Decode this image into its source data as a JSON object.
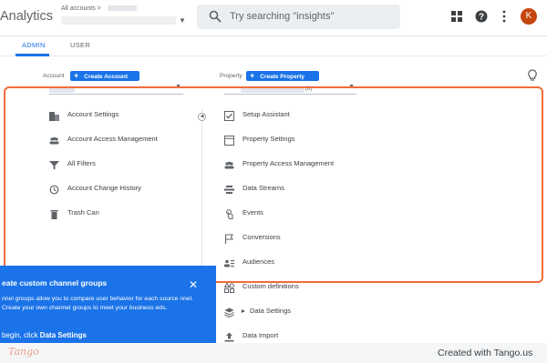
{
  "header": {
    "app_name": "Analytics",
    "all_accounts_label": "All accounts >",
    "search_placeholder": "Try searching \"insights\"",
    "avatar_initial": "K"
  },
  "tabs": [
    {
      "label": "ADMIN",
      "active": true
    },
    {
      "label": "USER",
      "active": false
    }
  ],
  "account_column": {
    "label": "Account",
    "create_button": "Create Account",
    "items": [
      {
        "icon": "building-icon",
        "label": "Account Settings"
      },
      {
        "icon": "people-icon",
        "label": "Account Access Management"
      },
      {
        "icon": "filter-icon",
        "label": "All Filters"
      },
      {
        "icon": "history-icon",
        "label": "Account Change History"
      },
      {
        "icon": "trash-icon",
        "label": "Trash Can"
      }
    ]
  },
  "property_column": {
    "label": "Property",
    "create_button": "Create Property",
    "selector_count": "(8)",
    "items": [
      {
        "icon": "checkbox-icon",
        "label": "Setup Assistant"
      },
      {
        "icon": "window-icon",
        "label": "Property Settings"
      },
      {
        "icon": "people-icon",
        "label": "Property Access Management"
      },
      {
        "icon": "streams-icon",
        "label": "Data Streams"
      },
      {
        "icon": "touch-icon",
        "label": "Events"
      },
      {
        "icon": "flag-icon",
        "label": "Conversions"
      },
      {
        "icon": "audience-icon",
        "label": "Audiences"
      },
      {
        "icon": "shapes-icon",
        "label": "Custom definitions"
      },
      {
        "icon": "stack-icon",
        "label": "Data Settings"
      },
      {
        "icon": "upload-icon",
        "label": "Data Import"
      }
    ]
  },
  "promo": {
    "title": "eate custom channel groups",
    "body": "nnel groups allow you to compare user behavior for each source nnel. Create your own channel groups to meet your business eds.",
    "footer_prefix": "begin, click ",
    "footer_emphasis": "Data Settings"
  },
  "footer": {
    "logo": "Tango",
    "credit": "Created with Tango.us"
  },
  "colors": {
    "accent": "#1a73e8",
    "highlight": "#f26b3a",
    "avatar": "#c5450f"
  }
}
